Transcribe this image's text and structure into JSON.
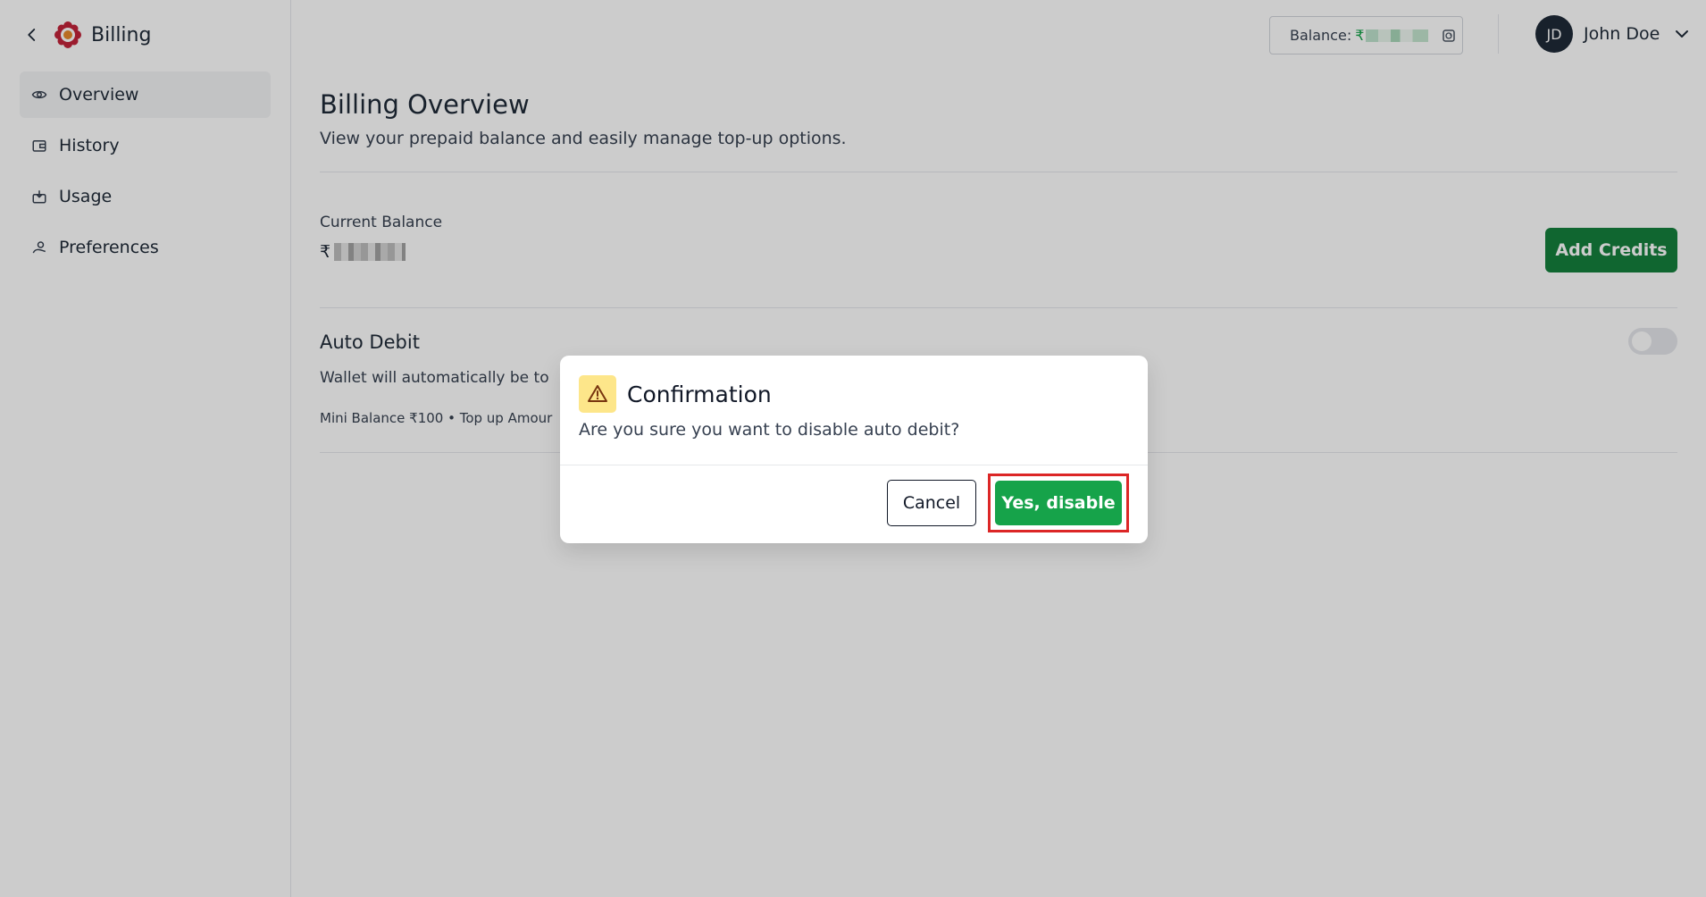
{
  "sidebar": {
    "brand_title": "Billing",
    "items": [
      {
        "label": "Overview",
        "icon": "eye-icon",
        "active": true
      },
      {
        "label": "History",
        "icon": "wallet-icon"
      },
      {
        "label": "Usage",
        "icon": "usage-icon"
      },
      {
        "label": "Preferences",
        "icon": "preferences-icon"
      }
    ]
  },
  "topbar": {
    "balance_label": "Balance:",
    "currency": "₹",
    "user_initials": "JD",
    "user_name": "John Doe"
  },
  "main": {
    "title": "Billing Overview",
    "subtitle": "View your prepaid balance and easily manage top-up options.",
    "current_balance_label": "Current Balance",
    "currency": "₹",
    "add_credits_label": "Add Credits",
    "auto_debit_title": "Auto Debit",
    "auto_debit_desc": "Wallet will automatically be to",
    "auto_debit_meta": "Mini Balance ₹100 • Top up Amour",
    "auto_debit_enabled": false
  },
  "modal": {
    "title": "Confirmation",
    "message": "Are you sure you want to disable auto debit?",
    "cancel_label": "Cancel",
    "confirm_label": "Yes, disable"
  },
  "colors": {
    "primary_green": "#15803d",
    "confirm_green": "#16a34a",
    "highlight_red": "#dc2626",
    "warning_bg": "#fde68a"
  }
}
